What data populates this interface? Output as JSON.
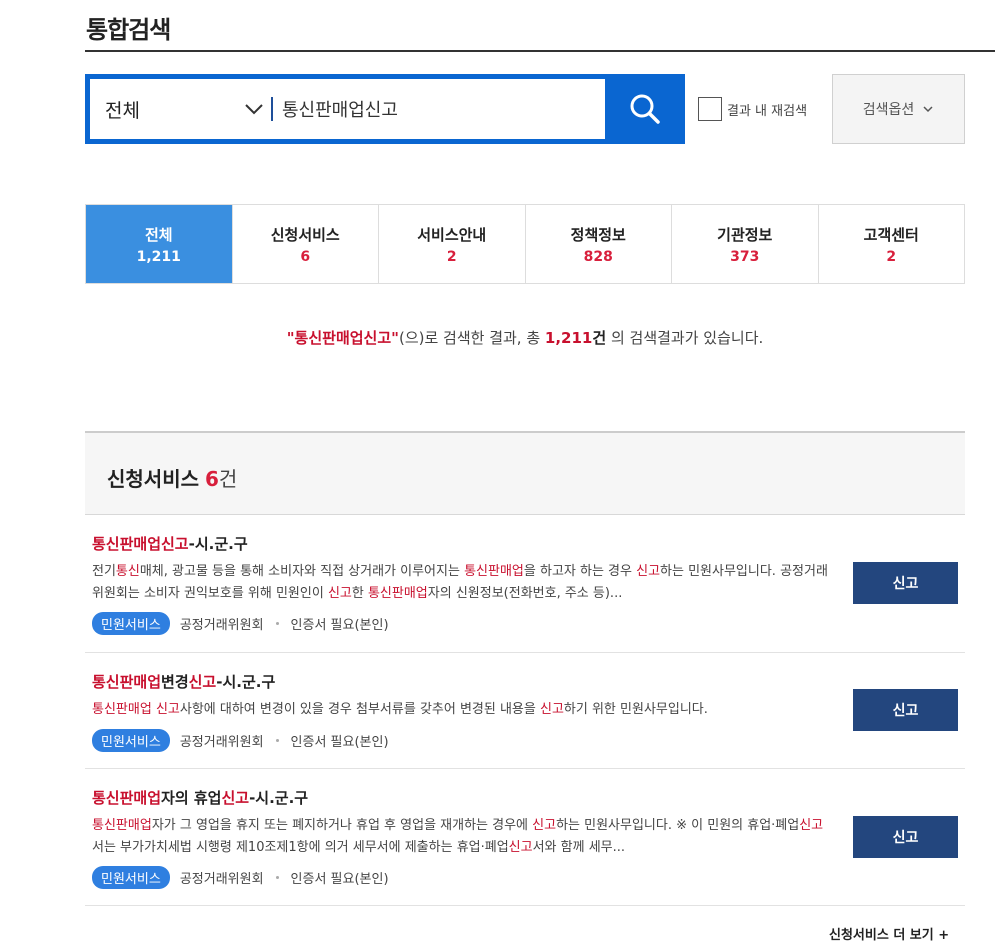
{
  "header": {
    "title": "통합검색"
  },
  "search": {
    "scope_label": "전체",
    "query": "통신판매업신고",
    "research_label": "결과 내 재검색",
    "options_label": "검색옵션"
  },
  "tabs": [
    {
      "name": "전체",
      "count": "1,211"
    },
    {
      "name": "신청서비스",
      "count": "6"
    },
    {
      "name": "서비스안내",
      "count": "2"
    },
    {
      "name": "정책정보",
      "count": "828"
    },
    {
      "name": "기관정보",
      "count": "373"
    },
    {
      "name": "고객센터",
      "count": "2"
    }
  ],
  "summary": {
    "query_quoted": "\"통신판매업신고\"",
    "text_a": "(으)로 검색한 결과, 총 ",
    "total": "1,211",
    "unit": "건",
    "text_b": " 의 검색결과가 있습니다."
  },
  "section": {
    "title": "신청서비스",
    "count": "6",
    "unit": "건"
  },
  "results": [
    {
      "title": [
        {
          "t": "통신판매업신고",
          "hl": true
        },
        {
          "t": "-시.군.구",
          "hl": false
        }
      ],
      "desc": [
        {
          "t": "전기",
          "hl": false
        },
        {
          "t": "통신",
          "hl": true
        },
        {
          "t": "매체, 광고물 등을 통해 소비자와 직접 상거래가 이루어지는 ",
          "hl": false
        },
        {
          "t": "통신판매업",
          "hl": true
        },
        {
          "t": "을 하고자 하는 경우 ",
          "hl": false
        },
        {
          "t": "신고",
          "hl": true
        },
        {
          "t": "하는 민원사무입니다. 공정거래위원회는 소비자 권익보호를 위해 민원인이 ",
          "hl": false
        },
        {
          "t": "신고",
          "hl": true
        },
        {
          "t": "한 ",
          "hl": false
        },
        {
          "t": "통신판매업",
          "hl": true
        },
        {
          "t": "자의 신원정보(전화번호, 주소 등)...",
          "hl": false
        }
      ],
      "badge": "민원서비스",
      "org": "공정거래위원회",
      "cert": "인증서 필요(본인)",
      "button": "신고"
    },
    {
      "title": [
        {
          "t": "통신판매업",
          "hl": true
        },
        {
          "t": "변경",
          "hl": false
        },
        {
          "t": "신고",
          "hl": true
        },
        {
          "t": "-시.군.구",
          "hl": false
        }
      ],
      "desc": [
        {
          "t": "통신판매업",
          "hl": true
        },
        {
          "t": " ",
          "hl": false
        },
        {
          "t": "신고",
          "hl": true
        },
        {
          "t": "사항에 대하여 변경이 있을 경우 첨부서류를 갖추어 변경된 내용을 ",
          "hl": false
        },
        {
          "t": "신고",
          "hl": true
        },
        {
          "t": "하기 위한 민원사무입니다.",
          "hl": false
        }
      ],
      "badge": "민원서비스",
      "org": "공정거래위원회",
      "cert": "인증서 필요(본인)",
      "button": "신고"
    },
    {
      "title": [
        {
          "t": "통신판매업",
          "hl": true
        },
        {
          "t": "자의 휴업",
          "hl": false
        },
        {
          "t": "신고",
          "hl": true
        },
        {
          "t": "-시.군.구",
          "hl": false
        }
      ],
      "desc": [
        {
          "t": "통신판매업",
          "hl": true
        },
        {
          "t": "자가 그 영업을 휴지 또는 폐지하거나 휴업 후 영업을 재개하는 경우에 ",
          "hl": false
        },
        {
          "t": "신고",
          "hl": true
        },
        {
          "t": "하는 민원사무입니다. ※ 이 민원의 휴업·폐업",
          "hl": false
        },
        {
          "t": "신고",
          "hl": true
        },
        {
          "t": "서는 부가가치세법 시행령 제10조제1항에 의거 세무서에 제출하는 휴업·폐업",
          "hl": false
        },
        {
          "t": "신고",
          "hl": true
        },
        {
          "t": "서와 함께 세무...",
          "hl": false
        }
      ],
      "badge": "민원서비스",
      "org": "공정거래위원회",
      "cert": "인증서 필요(본인)",
      "button": "신고"
    }
  ],
  "more_link": "신청서비스 더 보기 +",
  "colors": {
    "primary": "#0a66d1",
    "active_tab": "#3a8fe0",
    "highlight": "#c8102e",
    "button": "#23467e",
    "badge": "#2f7fe0"
  }
}
